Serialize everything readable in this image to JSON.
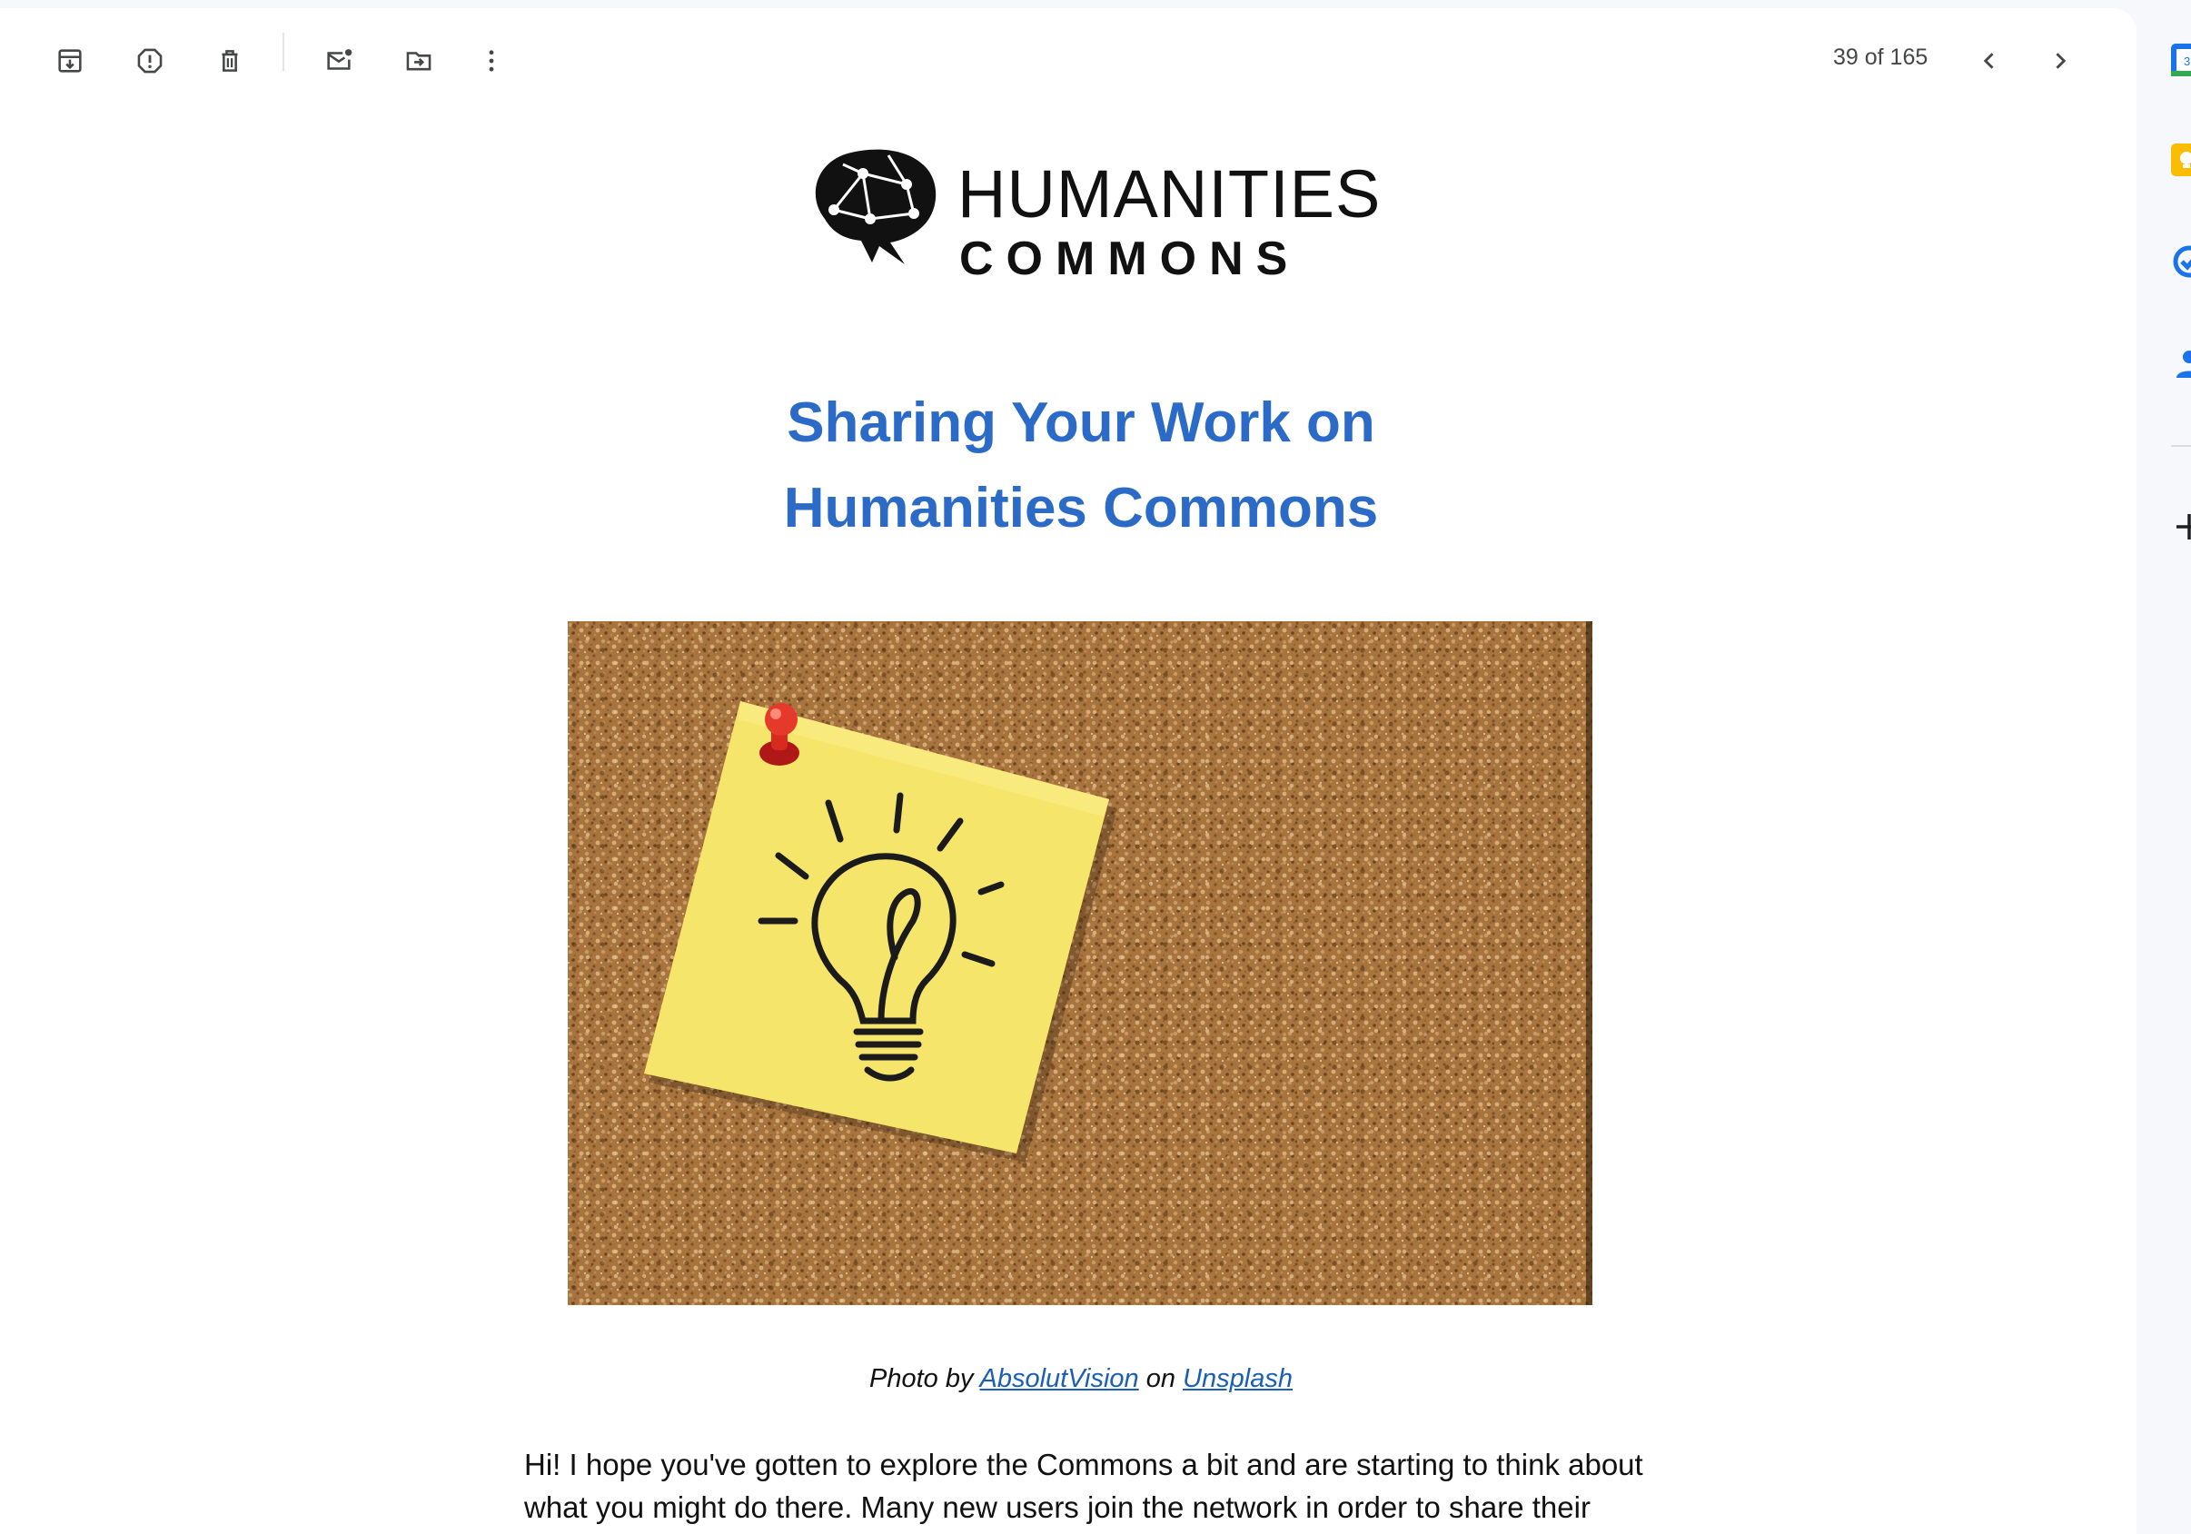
{
  "toolbar": {
    "archive_icon": "archive-icon",
    "spam_icon": "report-spam-icon",
    "delete_icon": "trash-icon",
    "unread_icon": "mark-unread-icon",
    "move_icon": "move-to-icon",
    "more_icon": "more-vert-icon",
    "counter": "39 of 165",
    "prev_icon": "chevron-left-icon",
    "next_icon": "chevron-right-icon"
  },
  "email": {
    "logo": {
      "line1": "HUMANITIES",
      "line2": "COMMONS"
    },
    "headline_line1": "Sharing Your Work on",
    "headline_line2": "Humanities Commons",
    "image_icon": "lightbulb-sticky-note-image",
    "caption": {
      "prefix": "Photo by",
      "author": "AbsolutVision",
      "middle": "on",
      "source": "Unsplash"
    },
    "body": "Hi! I hope you've gotten to explore the Commons a bit and are starting to think about what you might do there. Many new users join the network in order to share their"
  },
  "side_rail": {
    "calendar_icon": "calendar-icon",
    "keep_icon": "keep-icon",
    "tasks_icon": "tasks-icon",
    "contacts_icon": "contacts-icon",
    "add_icon": "add-icon"
  },
  "colors": {
    "headline": "#2b6bc7",
    "link": "#1a5fb4",
    "background": "#f6f8fc"
  }
}
